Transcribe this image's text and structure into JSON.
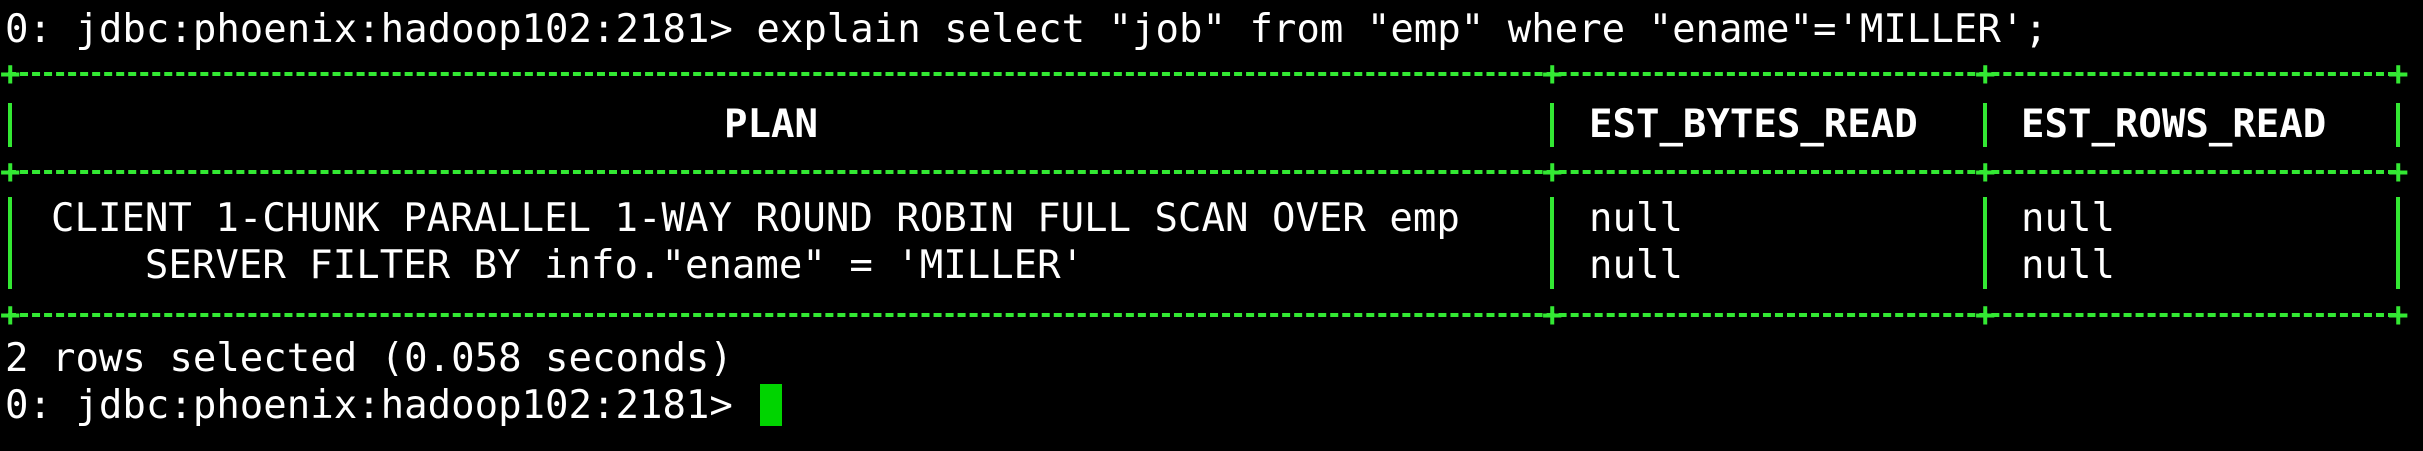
{
  "terminal": {
    "first_command_prompt": "0: jdbc:phoenix:hadoop102:2181> ",
    "first_command": "explain select \"job\" from \"emp\" where \"ename\"='MILLER';",
    "footer": "2 rows selected (0.058 seconds)",
    "second_prompt": "0: jdbc:phoenix:hadoop102:2181> "
  },
  "result_table": {
    "headers": [
      "PLAN",
      "EST_BYTES_READ",
      "EST_ROWS_READ"
    ],
    "rows": [
      [
        "CLIENT 1-CHUNK PARALLEL 1-WAY ROUND ROBIN FULL SCAN OVER emp",
        "null",
        "null"
      ],
      [
        "    SERVER FILTER BY info.\"ename\" = 'MILLER'",
        "null",
        "null"
      ]
    ]
  },
  "colors": {
    "background": "#000000",
    "text": "#ffffff",
    "table_border": "#33e833",
    "cursor": "#00d400"
  }
}
